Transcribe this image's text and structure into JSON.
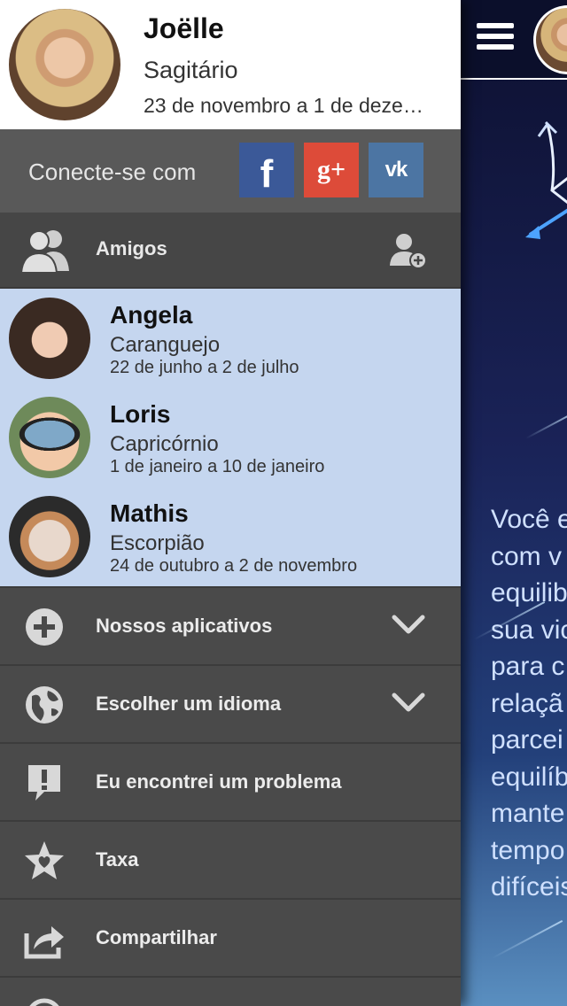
{
  "profile": {
    "name": "Joëlle",
    "sign": "Sagitário",
    "dates": "23 de novembro a 1 de deze…"
  },
  "connect": {
    "label": "Conecte-se com",
    "networks": [
      {
        "name": "facebook",
        "glyph": "f",
        "color": "#3b5998"
      },
      {
        "name": "google-plus",
        "glyph": "g+",
        "color": "#dd4b39"
      },
      {
        "name": "vk",
        "glyph": "vk",
        "color": "#4c75a3"
      }
    ]
  },
  "friends": {
    "header_label": "Amigos",
    "items": [
      {
        "name": "Angela",
        "sign": "Caranguejo",
        "dates": "22 de junho a 2 de julho"
      },
      {
        "name": "Loris",
        "sign": "Capricórnio",
        "dates": "1 de janeiro a 10 de janeiro"
      },
      {
        "name": "Mathis",
        "sign": "Escorpião",
        "dates": "24 de outubro a 2 de novembro"
      }
    ]
  },
  "menu": {
    "items": [
      {
        "label": "Nossos aplicativos",
        "icon": "plus-circle-icon",
        "expandable": true
      },
      {
        "label": "Escolher um idioma",
        "icon": "globe-icon",
        "expandable": true
      },
      {
        "label": "Eu encontrei um problema",
        "icon": "alert-bubble-icon",
        "expandable": false
      },
      {
        "label": "Taxa",
        "icon": "star-heart-icon",
        "expandable": false
      },
      {
        "label": "Compartilhar",
        "icon": "share-icon",
        "expandable": false
      }
    ]
  },
  "main": {
    "horoscope_text": "Você e\ncom v\nequilib\nsua vic\npara c\nrelaçã\nparcei\nequilíb\nmante\ntempo\ndifíceis"
  },
  "colors": {
    "drawer_bg": "#4a4a4a",
    "friends_bg": "#c5d6ef",
    "main_bg": "#1a2358"
  }
}
